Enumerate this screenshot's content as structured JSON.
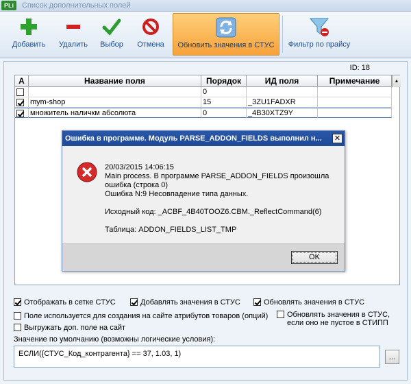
{
  "window": {
    "app_icon": "PLi",
    "title": "Список дополнительных полей"
  },
  "toolbar": {
    "add": {
      "label": "Добавить",
      "icon": "plus-icon",
      "color": "#2fa12f"
    },
    "delete": {
      "label": "Удалить",
      "icon": "minus-icon",
      "color": "#d02020"
    },
    "select": {
      "label": "Выбор",
      "icon": "checkmark-icon",
      "color": "#2e9c2e"
    },
    "cancel": {
      "label": "Отмена",
      "icon": "cancel-icon",
      "color": "#cc1f1f"
    },
    "update": {
      "label": "Обновить значения в СТУС",
      "icon": "refresh-icon",
      "active": true,
      "color": "#f7a23a"
    },
    "filter": {
      "label": "Фильтр по прайсу",
      "icon": "funnel-remove-icon"
    }
  },
  "record_id": "ID: 18",
  "grid": {
    "columns": [
      "А",
      "Название поля",
      "Порядок",
      "ИД поля",
      "Примечание"
    ],
    "rows": [
      {
        "checked": false,
        "name": "",
        "order": "0",
        "field_id": "",
        "note": ""
      },
      {
        "checked": true,
        "name": "mym-shop",
        "order": "15",
        "field_id": "_3ZU1FADXR",
        "note": ""
      },
      {
        "checked": true,
        "name": "множитель наличкм абсолюта",
        "order": "0",
        "field_id": "_4B30XTZ9Y",
        "note": "",
        "selected": true
      }
    ]
  },
  "options": {
    "show_in_grid": {
      "label": "Отображать в сетке СТУС",
      "checked": true
    },
    "add_values": {
      "label": "Добавлять значения в СТУС",
      "checked": true
    },
    "update_values": {
      "label": "Обновлять значения в СТУС",
      "checked": true
    },
    "site_attributes": {
      "label": "Поле используется для создания на сайте атрибутов товаров (опций)",
      "checked": false
    },
    "upload_to_site": {
      "label": "Выгружать доп. поле на сайт",
      "checked": false
    },
    "update_if_not_empty": {
      "label_line1": "Обновлять значения в СТУС,",
      "label_line2": "если оно не пустое в СТИПП",
      "checked": false
    }
  },
  "default_value": {
    "label": "Значение по умолчанию (возможны логические условия):",
    "value": "ЕСЛИ({СТУС_Код_контрагента} == 37, 1.03, 1)",
    "browse_button": "..."
  },
  "dialog": {
    "title": "Ошибка в программе. Модуль PARSE_ADDON_FIELDS выполнил н...",
    "close": "✕",
    "icon": "error-icon",
    "timestamp": "20/03/2015 14:06:15",
    "line1": "Main process. В программе PARSE_ADDON_FIELDS произошла",
    "line2": "ошибка (строка 0)",
    "line3": "Ошибка N:9 Несовпадение типа данных.",
    "source": "Исходный код:  _ACBF_4B40TOOZ6.CBM._ReflectCommand(6)",
    "table": "Таблица: ADDON_FIELDS_LIST_TMP",
    "ok_label": "OK"
  }
}
